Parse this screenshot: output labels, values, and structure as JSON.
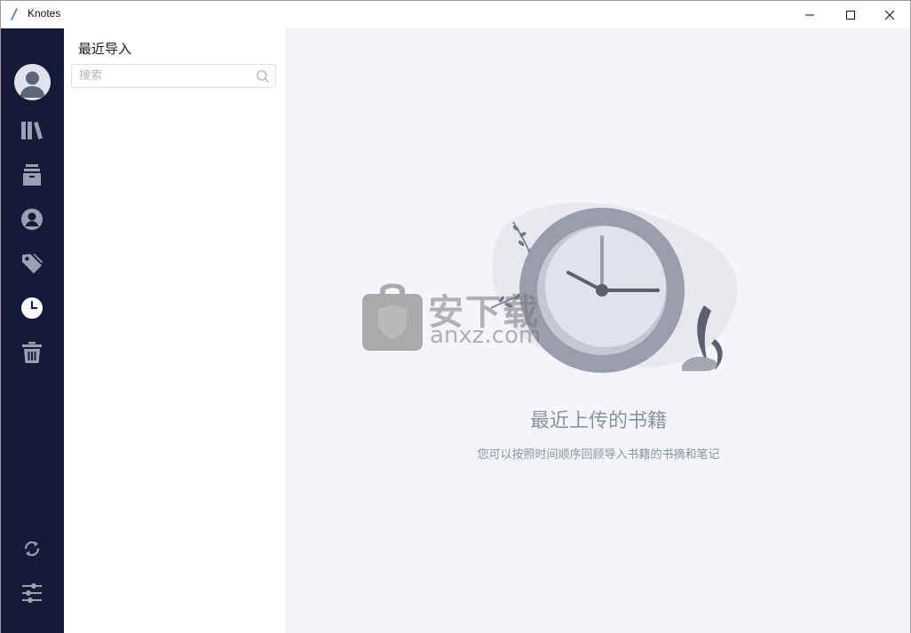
{
  "window": {
    "title": "Knotes"
  },
  "sidebar": {
    "items": [
      {
        "name": "library",
        "icon": "books-icon",
        "active": false
      },
      {
        "name": "archive",
        "icon": "archive-box-icon",
        "active": false
      },
      {
        "name": "authors",
        "icon": "person-circle-icon",
        "active": false
      },
      {
        "name": "tags",
        "icon": "tag-icon",
        "active": false
      },
      {
        "name": "recent",
        "icon": "clock-icon",
        "active": true
      },
      {
        "name": "trash",
        "icon": "trash-icon",
        "active": false
      }
    ],
    "bottom_items": [
      {
        "name": "sync",
        "icon": "sync-icon"
      },
      {
        "name": "settings",
        "icon": "sliders-icon"
      }
    ]
  },
  "list_panel": {
    "title": "最近导入",
    "search_placeholder": "搜索",
    "search_value": ""
  },
  "main": {
    "empty_title": "最近上传的书籍",
    "empty_subtitle": "您可以按照时间顺序回顾导入书籍的书摘和笔记"
  },
  "watermark": {
    "cn": "安下载",
    "en": "anxz.com"
  },
  "colors": {
    "rail_bg": "#161a36",
    "rail_icon": "#9aa0b4",
    "rail_icon_active": "#ffffff",
    "main_bg": "#f4f5f9",
    "muted_text": "#8d91a2"
  }
}
